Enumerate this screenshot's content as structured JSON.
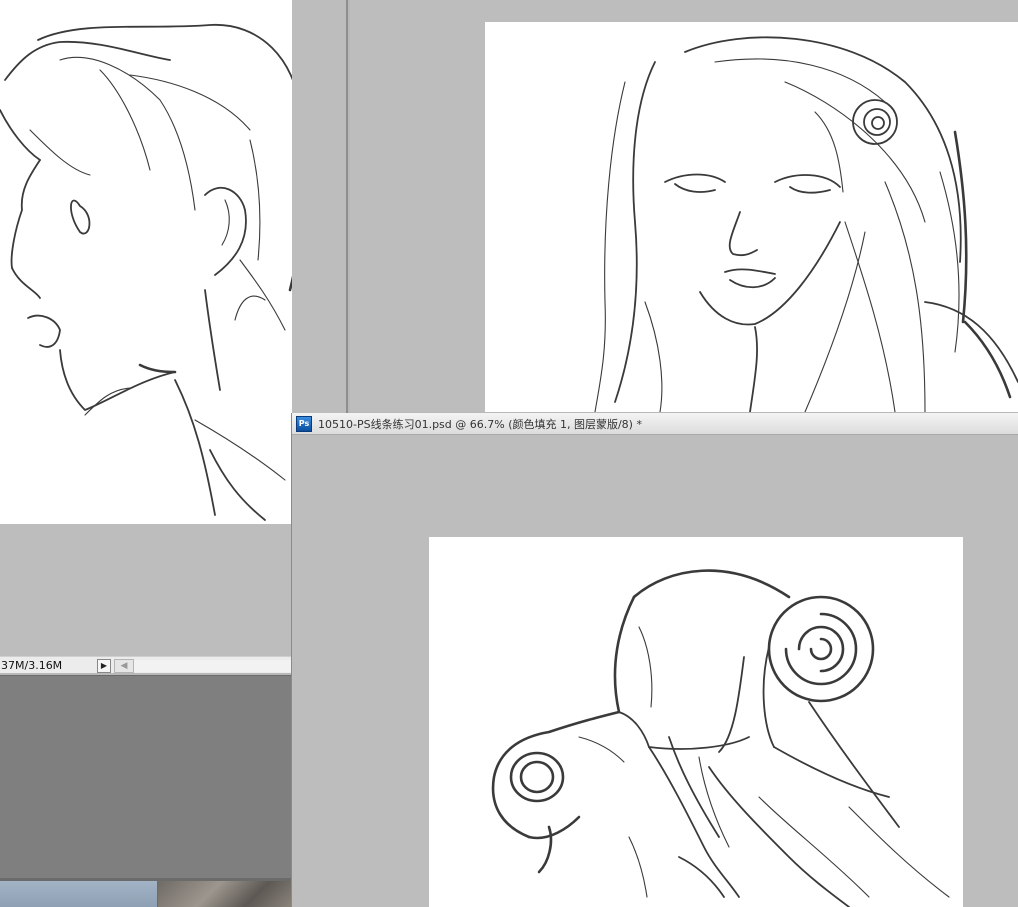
{
  "status_bar": {
    "doc_size": "37M/3.16M",
    "menu_arrow": "▶",
    "scroll_left_arrow": "◀"
  },
  "front_window": {
    "app_icon": "Ps",
    "title": "10510-PS线条练习01.psd @ 66.7% (颜色填充 1, 图层蒙版/8) *"
  },
  "icons": {
    "app_icon": "photoshop-icon",
    "status_menu": "triangle-right-icon",
    "scroll_left": "chevron-left-icon"
  },
  "colors": {
    "workspace_gray": "#bdbdbd",
    "canvas_white": "#ffffff",
    "panel_gray": "#7f7f7f",
    "titlebar_bg": "#e6e6e6",
    "ps_icon_blue": "#1b6fc5"
  }
}
